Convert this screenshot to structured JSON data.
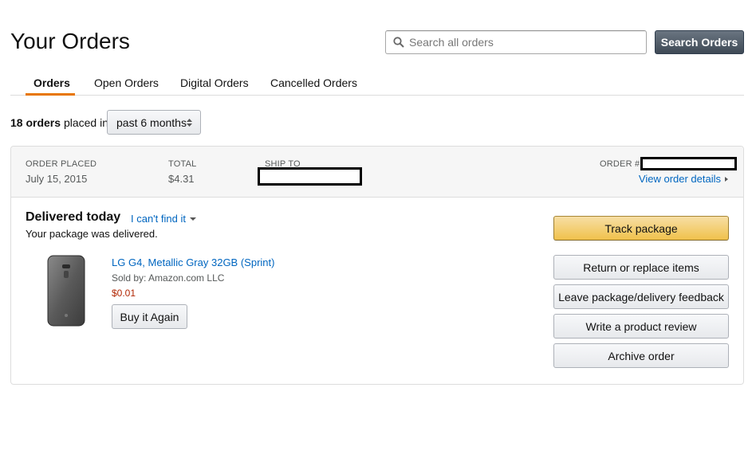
{
  "header": {
    "title": "Your Orders",
    "search_placeholder": "Search all orders",
    "search_button": "Search Orders"
  },
  "tabs": [
    {
      "label": "Orders",
      "active": true
    },
    {
      "label": "Open Orders",
      "active": false
    },
    {
      "label": "Digital Orders",
      "active": false
    },
    {
      "label": "Cancelled Orders",
      "active": false
    }
  ],
  "filter": {
    "count_text": "18 orders",
    "suffix_text": "placed in",
    "selected_period": "past 6 months"
  },
  "order": {
    "placed_label": "ORDER PLACED",
    "placed_value": "July 15, 2015",
    "total_label": "TOTAL",
    "total_value": "$4.31",
    "ship_to_label": "SHIP TO",
    "order_number_label": "ORDER #",
    "view_details": "View order details",
    "status": "Delivered today",
    "cant_find": "I can't find it",
    "status_detail": "Your package was delivered.",
    "item": {
      "title": "LG G4, Metallic Gray 32GB (Sprint)",
      "sold_by": "Sold by: Amazon.com LLC",
      "price": "$0.01",
      "buy_again": "Buy it Again"
    },
    "actions": {
      "track": "Track package",
      "return": "Return or replace items",
      "feedback": "Leave package/delivery feedback",
      "review": "Write a product review",
      "archive": "Archive order"
    }
  },
  "colors": {
    "link": "#0066c0",
    "price": "#b12704",
    "accent_tab": "#e77600",
    "primary_button": "#f0c14b"
  },
  "icons": {
    "search": "search-icon",
    "select": "sort-arrows-icon",
    "details": "chevron-right-icon",
    "dropdown": "chevron-down-icon"
  }
}
